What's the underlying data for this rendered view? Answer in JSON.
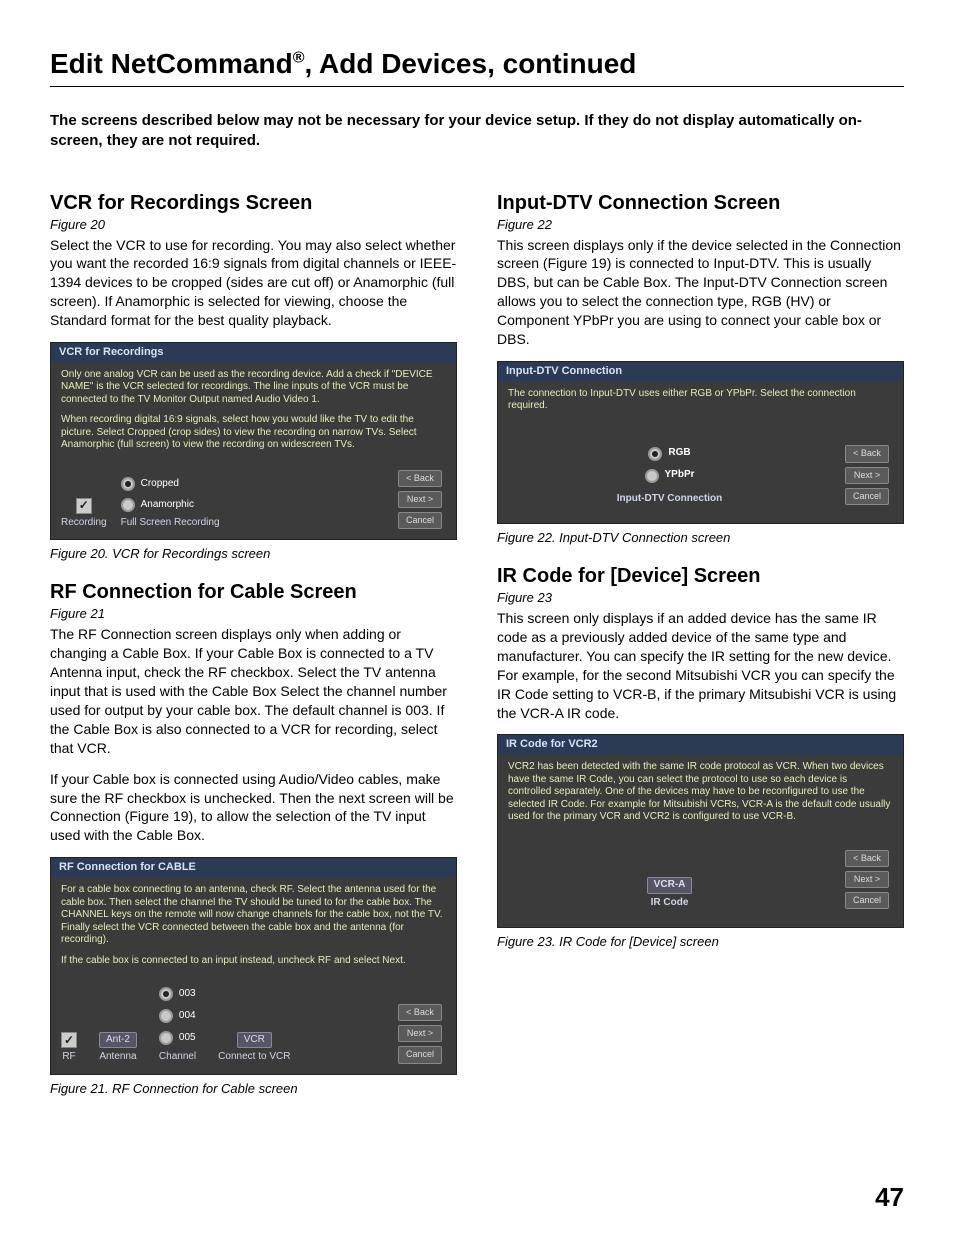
{
  "page_title_pre": "Edit NetCommand",
  "page_title_post": ", Add Devices, continued",
  "reg_mark": "®",
  "intro": "The screens described below may not be necessary for your device setup.  If they do not display automatically on-screen, they are not required.",
  "page_number": "47",
  "left": {
    "s1": {
      "title": "VCR for Recordings Screen",
      "figref": "Figure 20",
      "body": "Select the VCR to use for recording.  You may also select whether you want the recorded 16:9 signals from digital channels or IEEE-1394 devices to be cropped (sides are cut off) or Anamorphic (full screen).  If Anamorphic is selected for viewing, choose the Standard format for the best quality playback.",
      "shot": {
        "title": "VCR for Recordings",
        "note1": "Only one analog VCR can be used as the recording device.  Add a check if \"DEVICE NAME\" is the VCR selected for recordings.  The line inputs of the VCR must be connected to the TV Monitor Output named Audio Video 1.",
        "note2": "When recording digital 16:9 signals, select how you would like the TV to edit the picture.  Select Cropped (crop sides) to view the recording on narrow TVs.  Select Anamorphic (full screen) to view the recording on widescreen TVs.",
        "opt_cropped": "Cropped",
        "opt_anamorphic": "Anamorphic",
        "lbl_recording": "Recording",
        "lbl_fullscreen": "Full Screen Recording",
        "btn_back": "< Back",
        "btn_next": "Next >",
        "btn_cancel": "Cancel"
      },
      "caption": "Figure 20. VCR for Recordings screen"
    },
    "s2": {
      "title": "RF Connection for Cable Screen",
      "figref": "Figure 21",
      "body1": "The RF Connection screen displays only when adding or changing a Cable Box.  If your Cable Box is connected to a TV Antenna input, check the RF checkbox.  Select the TV antenna input that is used with the Cable Box  Select the channel number used for output by your cable box.  The default channel is 003. If the Cable Box is also connected to a VCR for recording, select that VCR.",
      "body2": "If your Cable box is connected using Audio/Video cables, make sure the RF checkbox is unchecked. Then the next screen will be Connection (Figure 19), to allow the selection of the TV input used with the Cable Box.",
      "shot": {
        "title": "RF Connection for CABLE",
        "note1": "For a cable box connecting to an antenna, check RF. Select the antenna used for the cable box.  Then select the channel the TV should be tuned to for the cable box.  The CHANNEL keys on the remote will now change channels for the cable box, not the TV. Finally select the VCR connected between the cable box and the antenna (for recording).",
        "note2": "If the cable box is connected to an input instead, uncheck RF and select Next.",
        "lbl_rf": "RF",
        "antenna_sel": "Ant-2",
        "lbl_antenna": "Antenna",
        "ch_003": "003",
        "ch_004": "004",
        "ch_005": "005",
        "lbl_channel": "Channel",
        "vcr_sel": "VCR",
        "lbl_connect_vcr": "Connect to VCR",
        "btn_back": "< Back",
        "btn_next": "Next >",
        "btn_cancel": "Cancel"
      },
      "caption": "Figure 21. RF Connection for Cable screen"
    }
  },
  "right": {
    "s1": {
      "title": "Input-DTV Connection Screen",
      "figref": "Figure 22",
      "body": "This screen displays only if the device selected in the Connection screen (Figure 19) is connected to Input-DTV.  This is usually DBS, but can be Cable Box.  The Input-DTV Connection screen allows you to select the connection type, RGB (HV) or Component YPbPr you are using to connect your cable box or DBS.",
      "shot": {
        "title": "Input-DTV Connection",
        "note": "The connection to Input-DTV uses either RGB or YPbPr.  Select the connection required.",
        "opt_rgb": "RGB",
        "opt_ypbpr": "YPbPr",
        "lbl_bottom": "Input-DTV Connection",
        "btn_back": "< Back",
        "btn_next": "Next >",
        "btn_cancel": "Cancel"
      },
      "caption": "Figure 22. Input-DTV Connection screen"
    },
    "s2": {
      "title": "IR Code for [Device] Screen",
      "figref": "Figure 23",
      "body": "This screen only displays if an added device has the same IR code as a previously added device of the same type and manufacturer.  You can specify the IR setting for the new device.  For example, for the second Mitsubishi VCR you can specify the IR Code setting to VCR-B, if the primary Mitsubishi VCR is using the VCR-A IR code.",
      "shot": {
        "title": "IR Code for VCR2",
        "note": "VCR2 has been detected with the same IR code protocol as VCR.  When two devices have the same IR Code, you can select the protocol to use so each device is controlled separately. One of the devices may have to be reconfigured to use the selected IR Code.  For example for Mitsubishi VCRs, VCR-A is the default code usually used for the primary VCR and VCR2 is configured to use VCR-B.",
        "sel": "VCR-A",
        "lbl_ircode": "IR Code",
        "btn_back": "< Back",
        "btn_next": "Next >",
        "btn_cancel": "Cancel"
      },
      "caption": "Figure 23. IR Code for [Device] screen"
    }
  }
}
